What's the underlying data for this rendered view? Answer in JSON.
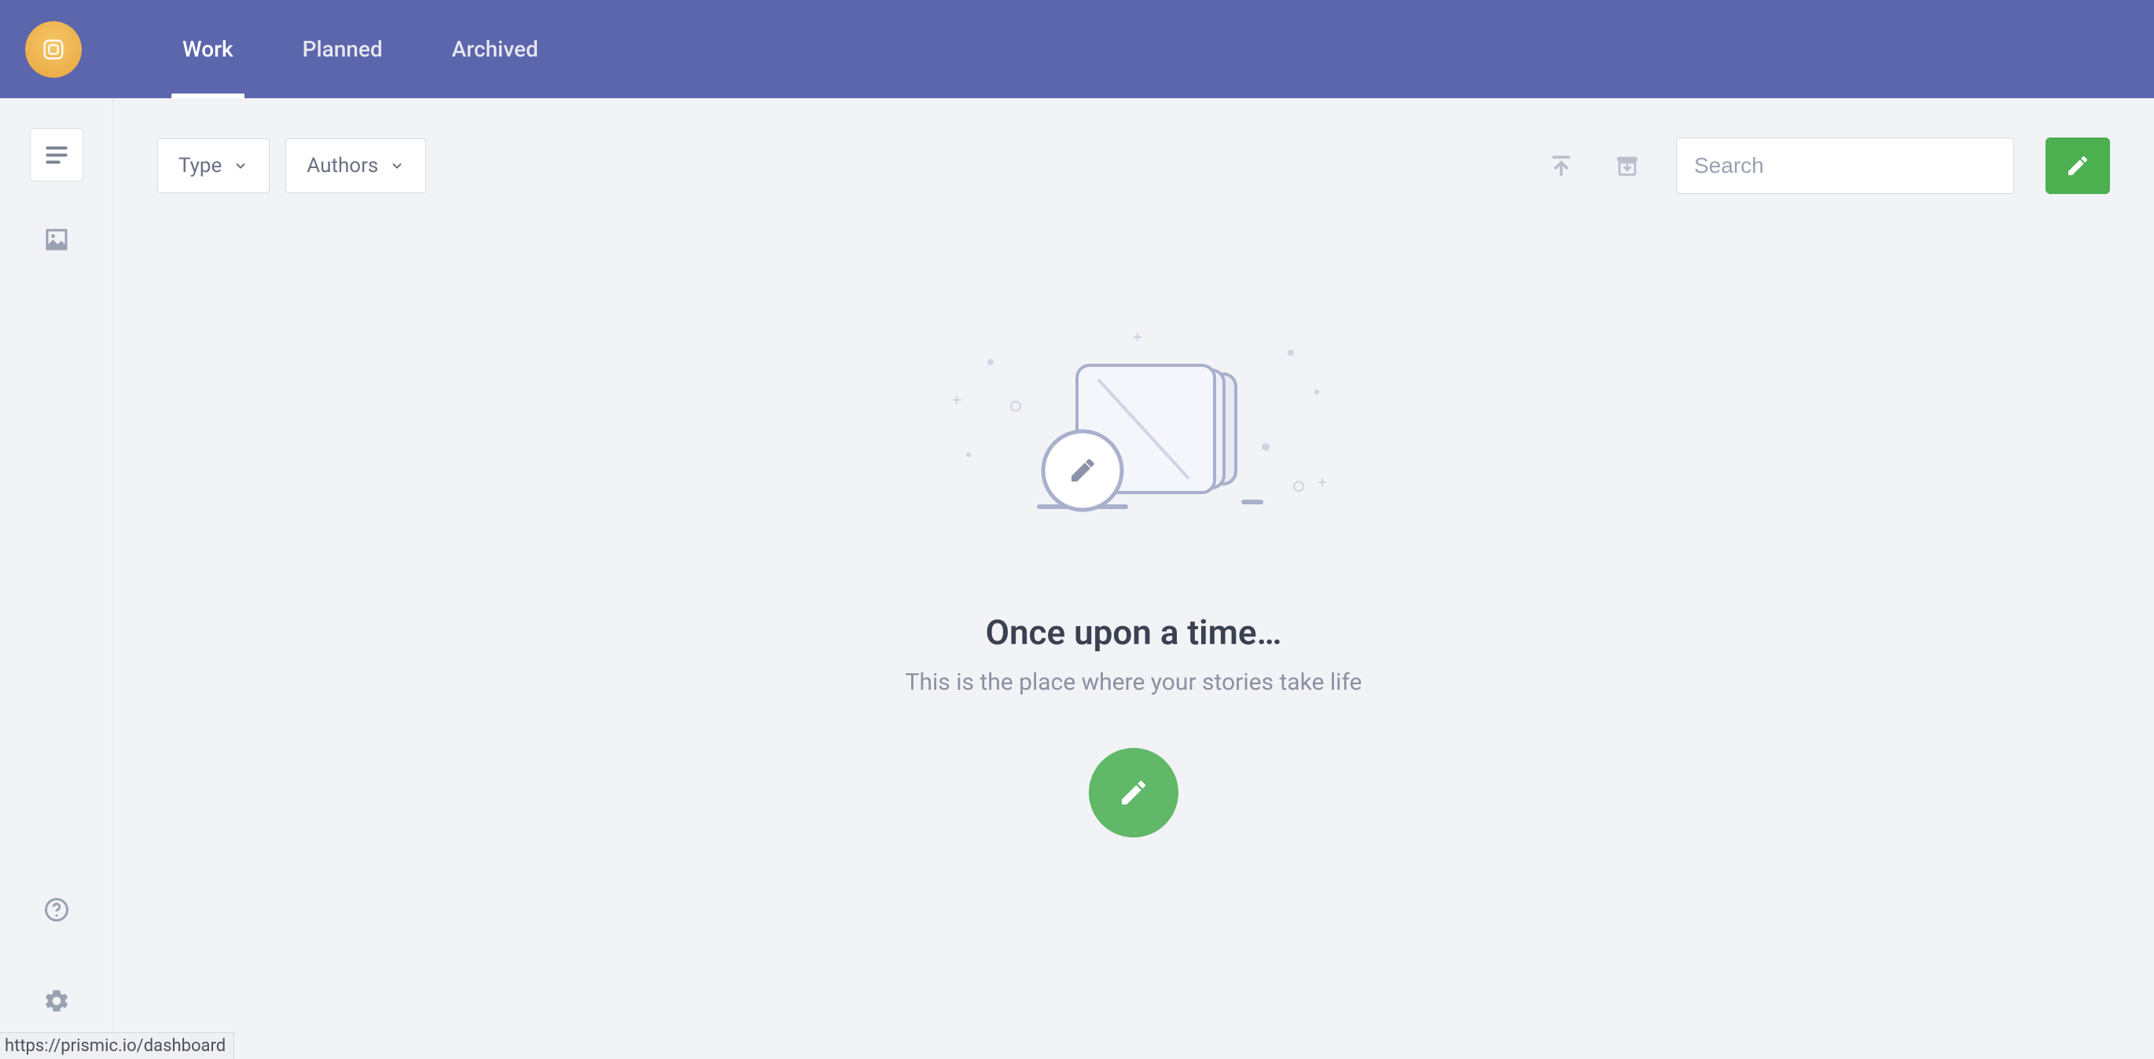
{
  "header": {
    "tabs": [
      {
        "id": "work",
        "label": "Work",
        "active": true
      },
      {
        "id": "planned",
        "label": "Planned",
        "active": false
      },
      {
        "id": "archived",
        "label": "Archived",
        "active": false
      }
    ]
  },
  "rail": {
    "top": [
      {
        "id": "documents",
        "icon": "text-lines-icon",
        "active": true
      },
      {
        "id": "media",
        "icon": "image-icon",
        "active": false
      }
    ],
    "bottom": [
      {
        "id": "help",
        "icon": "help-circle-icon"
      },
      {
        "id": "settings",
        "icon": "gear-icon"
      }
    ]
  },
  "toolbar": {
    "filters": {
      "type": {
        "label": "Type"
      },
      "authors": {
        "label": "Authors"
      }
    },
    "actions": {
      "upload_icon": "upload-icon",
      "archive_icon": "archive-box-icon"
    },
    "search": {
      "placeholder": "Search",
      "value": ""
    },
    "compose_icon": "pencil-icon"
  },
  "empty_state": {
    "title": "Once upon a time…",
    "subtitle": "This is the place where your stories take life",
    "cta_icon": "pencil-icon"
  },
  "statusbar": {
    "text": "https://prismic.io/dashboard"
  }
}
